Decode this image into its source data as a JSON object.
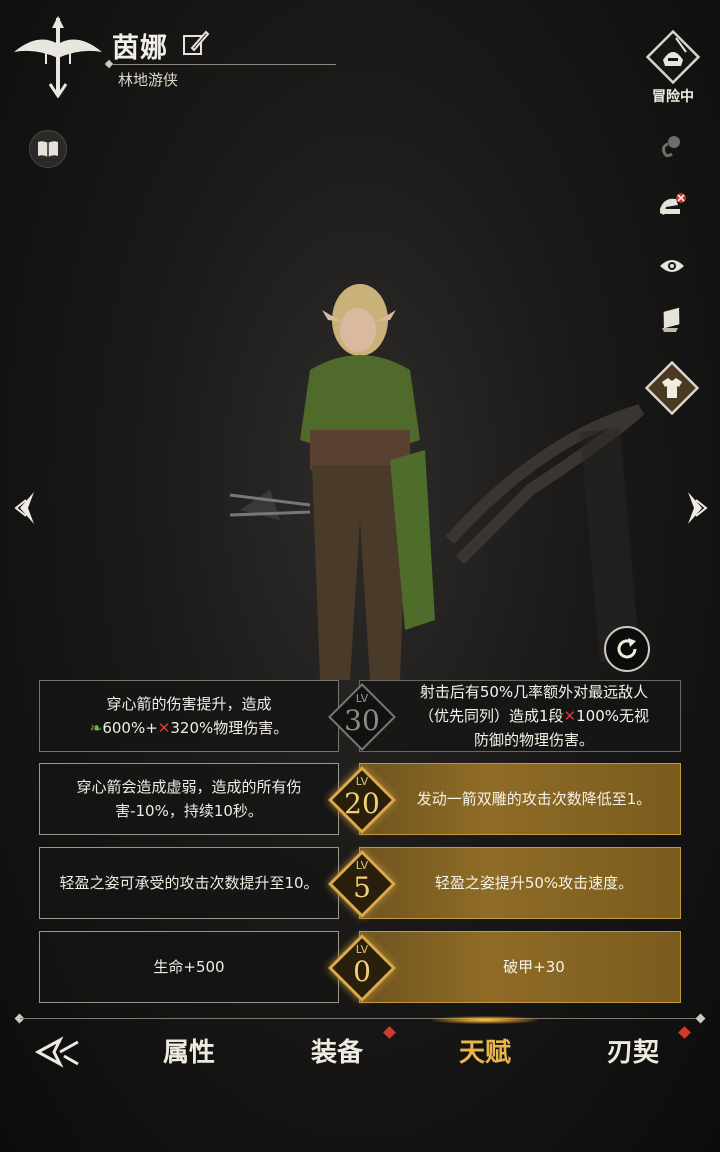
{
  "header": {
    "name": "茵娜",
    "subtitle": "林地游侠"
  },
  "right_panel": {
    "adventure_label": "冒险中"
  },
  "talents": [
    {
      "left_text": "",
      "left_line1": "穿心箭的伤害提升，造成",
      "left_line2_a": "600%+",
      "left_line2_b": "320%物理伤害。",
      "level_label": "LV",
      "level": "30",
      "right_line1": "射击后有50%几率额外对最远敌人",
      "right_line2_a": "（优先同列）造成1段",
      "right_line2_b": "100%无视",
      "right_line3": "防御的物理伤害。",
      "active": false
    },
    {
      "left_text": "穿心箭会造成虚弱，造成的所有伤害-10%，持续10秒。",
      "level_label": "LV",
      "level": "20",
      "right_text": "发动一箭双雕的攻击次数降低至1。",
      "active": true
    },
    {
      "left_text": "轻盈之姿可承受的攻击次数提升至10。",
      "level_label": "LV",
      "level": "5",
      "right_text": "轻盈之姿提升50%攻击速度。",
      "active": true
    },
    {
      "left_text": "生命+500",
      "level_label": "LV",
      "level": "0",
      "right_text": "破甲+30",
      "active": true
    }
  ],
  "nav": {
    "tabs": [
      "属性",
      "装备",
      "天赋",
      "刃契"
    ],
    "active_tab": "天赋"
  },
  "colors": {
    "accent_gold": "#d9a94a",
    "badge_red": "#d23b2a"
  }
}
